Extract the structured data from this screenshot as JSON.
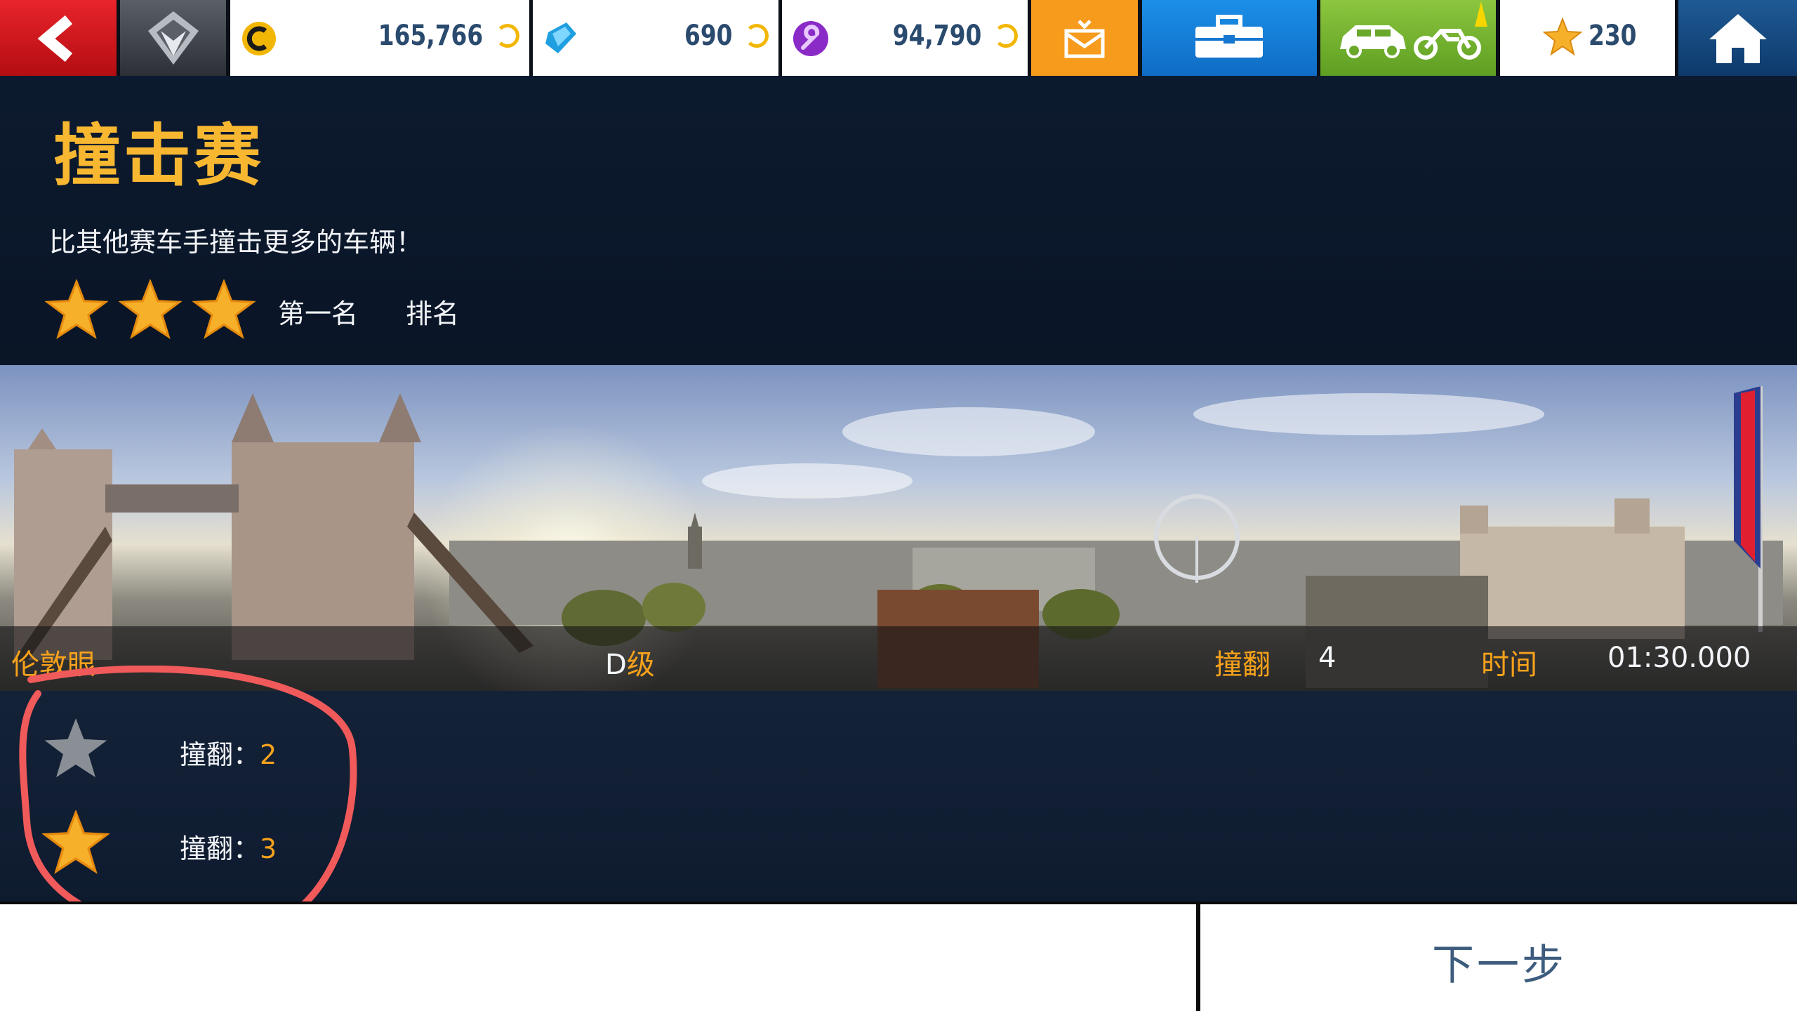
{
  "topbar": {
    "back_icon": "chevron-left-icon",
    "rank_icon": "rank-emblem-icon",
    "credits": "165,766",
    "tokens": "690",
    "fusion": "94,790",
    "mail_icon": "mail-download-icon",
    "toolbox_icon": "toolbox-icon",
    "garage_icon": "car-motorbike-icon",
    "star_count": "230",
    "home_icon": "home-icon"
  },
  "event": {
    "title": "撞击赛",
    "description": "比其他赛车手撞击更多的车辆！",
    "stars_filled": 3,
    "condition_1": "第一名",
    "condition_2": "排名"
  },
  "track": {
    "location": "伦敦眼",
    "class_prefix": "D",
    "class_suffix": "级",
    "crash_label": "撞翻",
    "crash_value": "4",
    "time_label": "时间",
    "time_value": "01:30.000"
  },
  "goals": [
    {
      "label": "撞翻：",
      "value": "2",
      "star": "gray"
    },
    {
      "label": "撞翻：",
      "value": "3",
      "star": "gold"
    }
  ],
  "footer": {
    "next_label": "下一步"
  },
  "colors": {
    "accent_orange": "#f7a21b",
    "title_gold": "#f7b731",
    "back_red": "#e8242b",
    "annotation_red": "#f05a5a"
  }
}
